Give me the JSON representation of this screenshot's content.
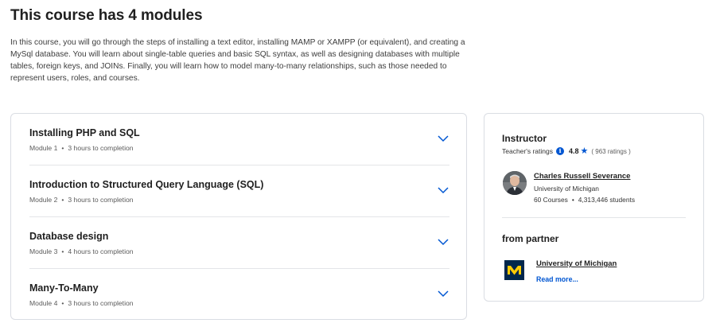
{
  "section": {
    "title": "This course has 4 modules",
    "description": "In this course, you will go through the steps of installing a text editor, installing MAMP or XAMPP (or equivalent), and creating a MySql database. You will learn about single-table queries and basic SQL syntax, as well as designing databases with multiple tables, foreign keys, and JOINs. Finally, you will learn how to model many-to-many relationships, such as those needed to represent users, roles, and courses."
  },
  "modules": [
    {
      "title": "Installing PHP and SQL",
      "number": "Module 1",
      "duration": "3 hours to completion"
    },
    {
      "title": "Introduction to Structured Query Language (SQL)",
      "number": "Module 2",
      "duration": "3 hours to completion"
    },
    {
      "title": "Database design",
      "number": "Module 3",
      "duration": "4 hours to completion"
    },
    {
      "title": "Many-To-Many",
      "number": "Module 4",
      "duration": "3 hours to completion"
    }
  ],
  "icons": {
    "expand": "chevron-down-icon",
    "info": "info-icon",
    "star": "star-icon"
  },
  "colors": {
    "accent": "#0056d2",
    "partner_logo_bg": "#00274c",
    "partner_logo_fg": "#ffcb05"
  },
  "instructor": {
    "heading": "Instructor",
    "ratings_label": "Teacher's ratings",
    "rating": "4.8",
    "ratings_count": "( 963 ratings )",
    "name": "Charles Russell Severance",
    "organization": "University of Michigan",
    "courses": "60 Courses",
    "students": "4,313,446 students"
  },
  "partner": {
    "heading": "from partner",
    "name": "University of Michigan",
    "read_more": "Read more..."
  }
}
